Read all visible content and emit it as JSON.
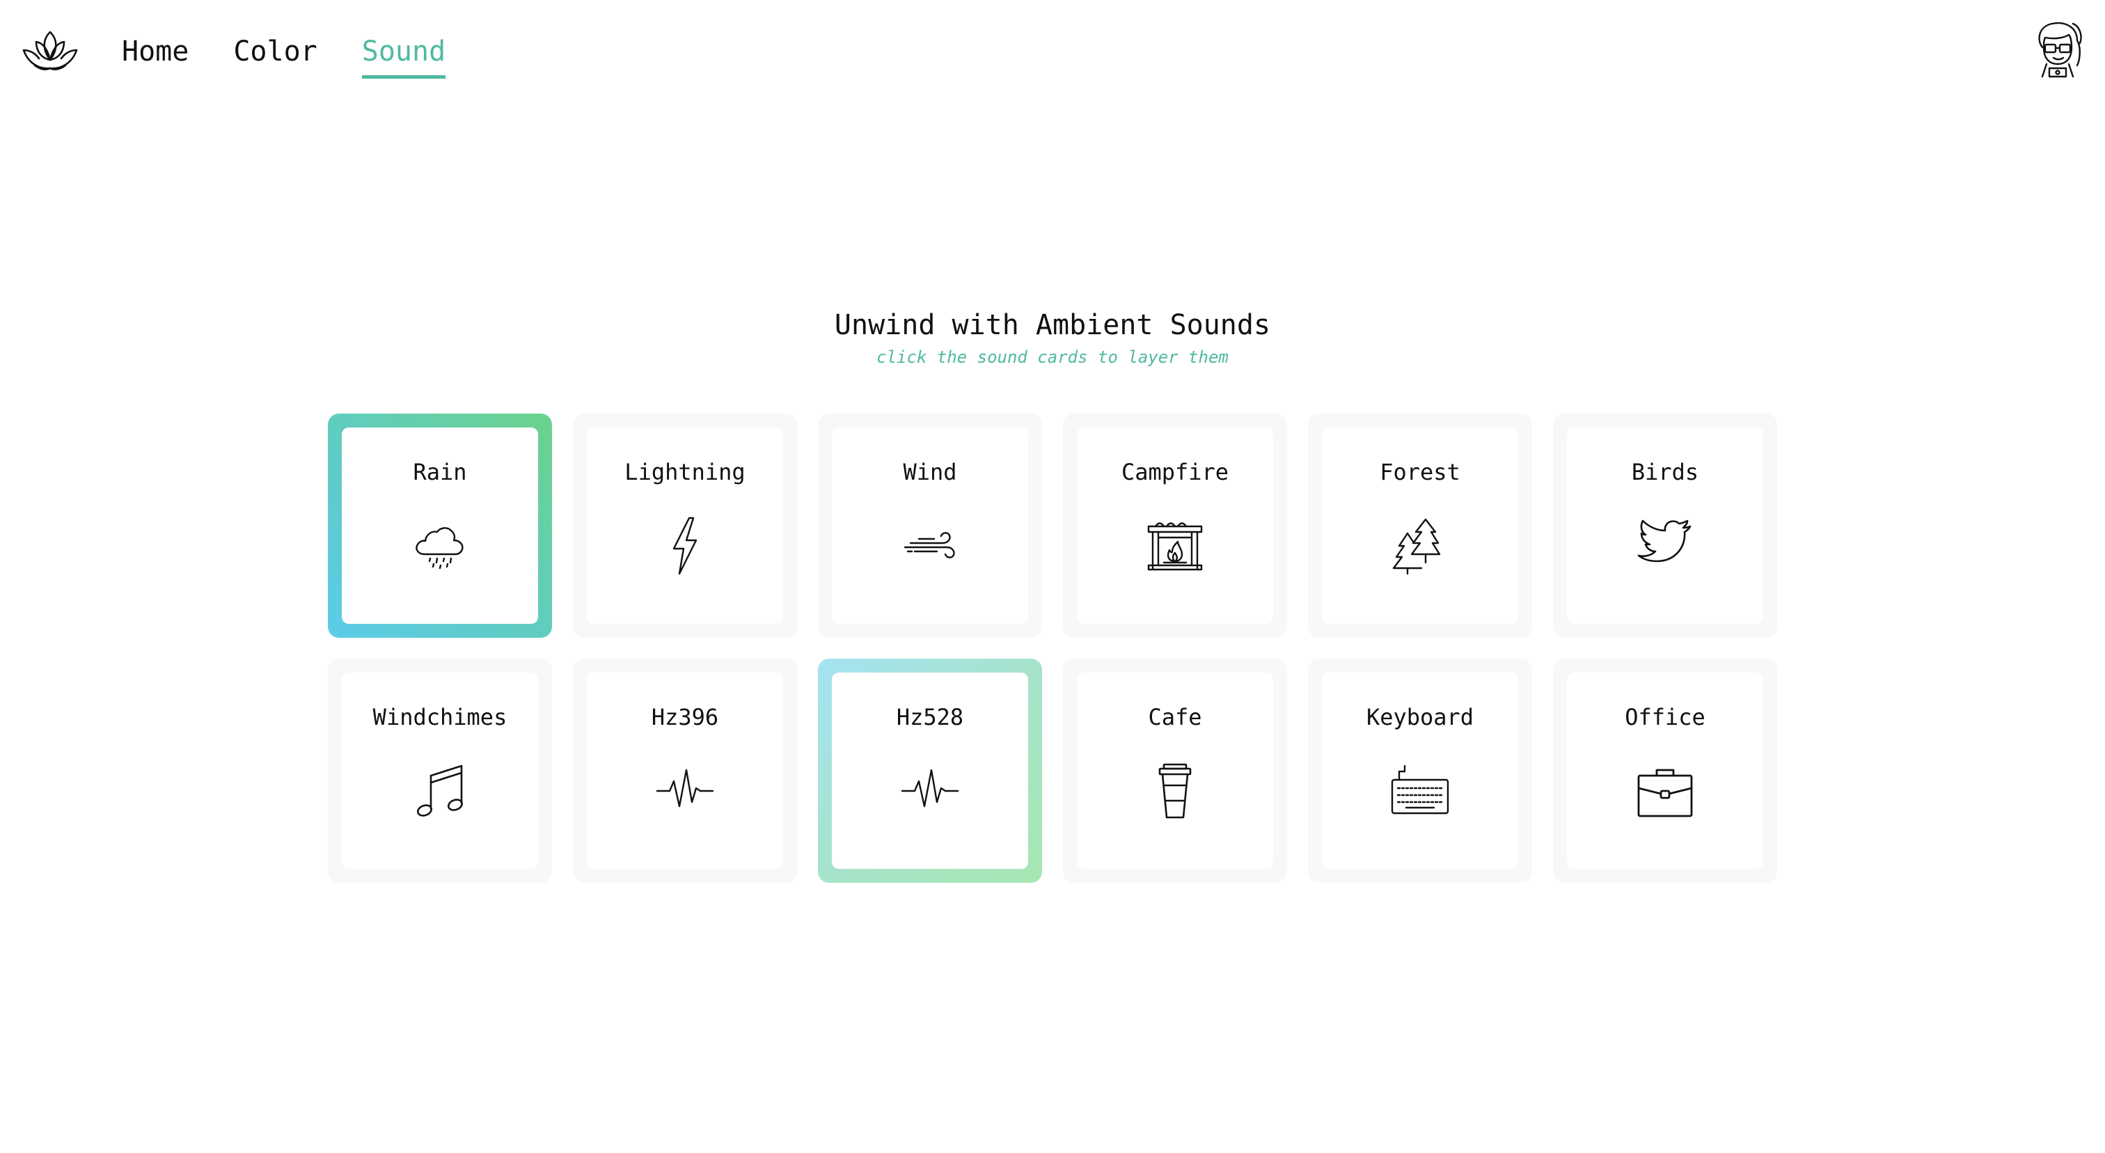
{
  "nav": {
    "logo_icon": "lotus-icon",
    "links": [
      {
        "label": "Home",
        "active": false
      },
      {
        "label": "Color",
        "active": false
      },
      {
        "label": "Sound",
        "active": true
      }
    ],
    "avatar_icon": "user-avatar-icon"
  },
  "hero": {
    "title": "Unwind with Ambient Sounds",
    "subtitle": "click the sound cards to layer them"
  },
  "colors": {
    "accent": "#4fb9a1",
    "card_bg": "#f7f8fa",
    "active_gradient_a": [
      "#5bcbe9",
      "#6bd28a"
    ],
    "active_gradient_b": [
      "#a9e3f3",
      "#a7e6b6"
    ]
  },
  "sounds": [
    {
      "label": "Rain",
      "icon": "rain-cloud-icon",
      "active": true
    },
    {
      "label": "Lightning",
      "icon": "lightning-icon",
      "active": false
    },
    {
      "label": "Wind",
      "icon": "wind-icon",
      "active": false
    },
    {
      "label": "Campfire",
      "icon": "fireplace-icon",
      "active": false
    },
    {
      "label": "Forest",
      "icon": "pine-trees-icon",
      "active": false
    },
    {
      "label": "Birds",
      "icon": "bird-icon",
      "active": false
    },
    {
      "label": "Windchimes",
      "icon": "music-note-icon",
      "active": false
    },
    {
      "label": "Hz396",
      "icon": "pulse-wave-icon",
      "active": false
    },
    {
      "label": "Hz528",
      "icon": "pulse-wave-icon",
      "active": true
    },
    {
      "label": "Cafe",
      "icon": "coffee-cup-icon",
      "active": false
    },
    {
      "label": "Keyboard",
      "icon": "keyboard-icon",
      "active": false
    },
    {
      "label": "Office",
      "icon": "briefcase-icon",
      "active": false
    }
  ]
}
